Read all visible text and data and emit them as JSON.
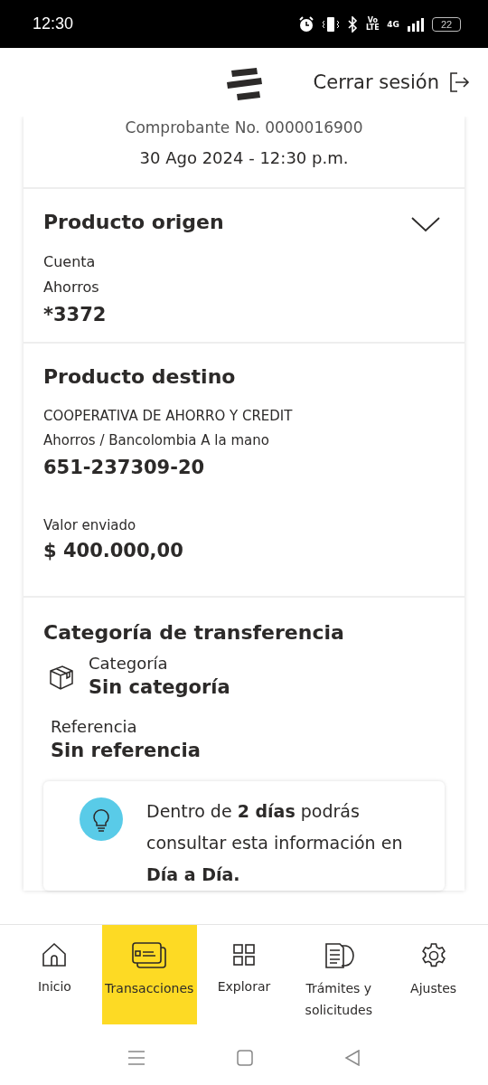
{
  "status_bar": {
    "time": "12:30",
    "volte": "Vo LTE",
    "network": "4G",
    "battery": "22"
  },
  "header": {
    "logout": "Cerrar sesión"
  },
  "receipt": {
    "number": "Comprobante No. 0000016900",
    "date": "30 Ago 2024 - 12:30 p.m."
  },
  "origin": {
    "title": "Producto origen",
    "expanded": false,
    "lines": [
      "Cuenta",
      "Ahorros"
    ],
    "account": "*3372"
  },
  "destination": {
    "title": "Producto destino",
    "lines": [
      "COOPERATIVA DE AHORRO Y CREDIT",
      "Ahorros / Bancolombia A la mano"
    ],
    "account": "651-237309-20",
    "amount_label": "Valor enviado",
    "amount": "$ 400.000,00"
  },
  "category": {
    "title": "Categoría de transferencia",
    "category_label": "Categoría",
    "category_value": "Sin categoría",
    "reference_label": "Referencia",
    "reference_value": "Sin referencia",
    "tip": "Dentro de **2 días** podrás consultar esta información en **Día a Día.**"
  },
  "bottom_nav": [
    {
      "label": "Inicio",
      "selected": false
    },
    {
      "label": "Transacciones",
      "selected": true
    },
    {
      "label": "Explorar",
      "selected": false
    },
    {
      "label": "Trámites y solicitudes",
      "selected": false
    },
    {
      "label": "Ajustes",
      "selected": false
    }
  ]
}
